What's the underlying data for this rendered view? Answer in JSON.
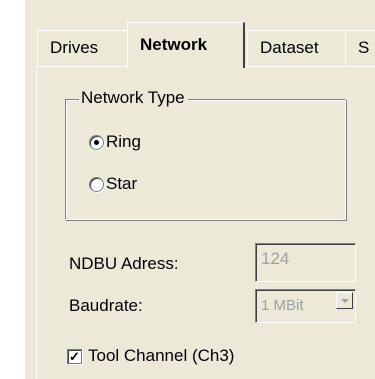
{
  "tabs": [
    {
      "label": "Drives",
      "active": false
    },
    {
      "label": "Network",
      "active": true
    },
    {
      "label": "Dataset",
      "active": false
    },
    {
      "label": "S",
      "active": false
    }
  ],
  "network_type": {
    "title": "Network Type",
    "options": [
      {
        "label": "Ring",
        "selected": true
      },
      {
        "label": "Star",
        "selected": false
      }
    ]
  },
  "ndbu": {
    "label": "NDBU Adress:",
    "value": "124"
  },
  "baudrate": {
    "label": "Baudrate:",
    "value": "1 MBit"
  },
  "tool_channel": {
    "label": "Tool Channel (Ch3)",
    "checked": true
  },
  "icons": {
    "radio": "radio-button",
    "combo": "chevron-down-icon",
    "check": "checkmark-icon"
  }
}
